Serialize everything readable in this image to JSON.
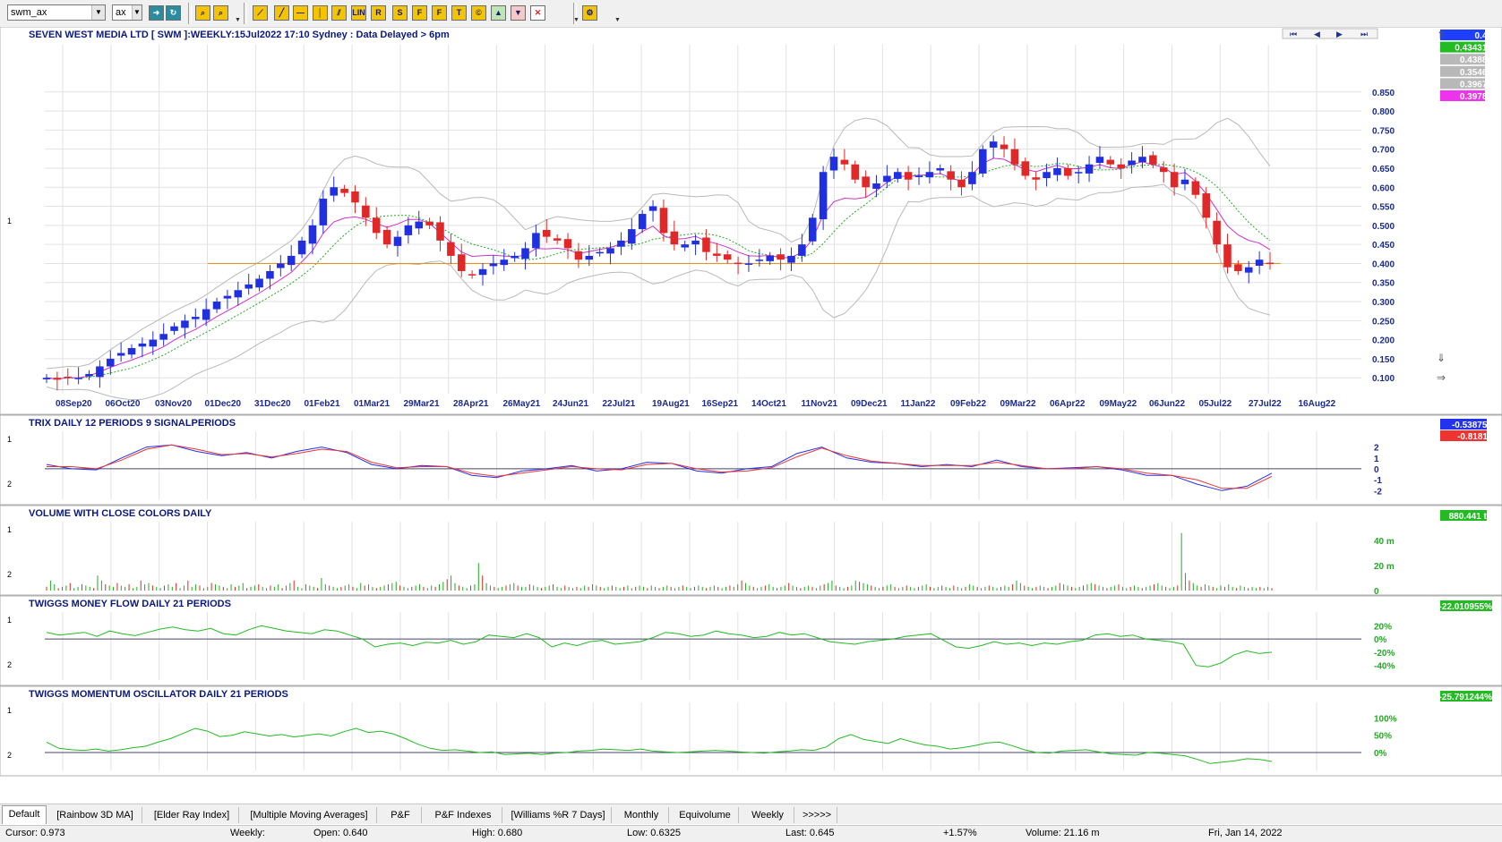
{
  "toolbar": {
    "symbol_value": "swm_ax",
    "exchange_value": "ax",
    "buttons": [
      {
        "name": "binoculars-icon",
        "glyph": "⌕"
      },
      {
        "name": "binoculars-disabled-icon",
        "glyph": "⌕"
      },
      {
        "name": "trendline-icon",
        "glyph": "⟋"
      },
      {
        "name": "line-icon",
        "glyph": "╱"
      },
      {
        "name": "horizontal-line-icon",
        "glyph": "—"
      },
      {
        "name": "vertical-line-icon",
        "glyph": "│"
      },
      {
        "name": "parallel-lines-icon",
        "glyph": "⫽"
      },
      {
        "name": "lin-regression-icon",
        "glyph": "LIN"
      },
      {
        "name": "raff-channel-icon",
        "glyph": "R"
      },
      {
        "name": "std-channel-icon",
        "glyph": "S"
      },
      {
        "name": "fib-icon",
        "glyph": "F"
      },
      {
        "name": "fib-time-icon",
        "glyph": "F"
      },
      {
        "name": "text-note-icon",
        "glyph": "T"
      },
      {
        "name": "copyright-icon",
        "glyph": "©"
      },
      {
        "name": "up-arrow-icon",
        "glyph": "▲"
      },
      {
        "name": "down-arrow-icon",
        "glyph": "▼"
      },
      {
        "name": "delete-icon",
        "glyph": "✕"
      },
      {
        "name": "settings-tool-icon",
        "glyph": "⚙"
      }
    ]
  },
  "main_chart": {
    "title": "SEVEN WEST MEDIA LTD [ SWM ]:WEEKLY:15Jul2022 17:10 Sydney : Data Delayed > 6pm",
    "y_ticks": [
      "0.850",
      "0.800",
      "0.750",
      "0.700",
      "0.650",
      "0.600",
      "0.550",
      "0.500",
      "0.450",
      "0.400",
      "0.350",
      "0.300",
      "0.250",
      "0.200",
      "0.150",
      "0.100"
    ],
    "x_ticks": [
      "08Sep20",
      "06Oct20",
      "03Nov20",
      "01Dec20",
      "31Dec20",
      "01Feb21",
      "01Mar21",
      "29Mar21",
      "28Apr21",
      "26May21",
      "24Jun21",
      "22Jul21",
      "19Aug21",
      "16Sep21",
      "14Oct21",
      "11Nov21",
      "09Dec21",
      "11Jan22",
      "09Feb22",
      "09Mar22",
      "06Apr22",
      "09May22",
      "06Jun22",
      "05Jul22",
      "27Jul22",
      "16Aug22"
    ],
    "value_boxes": [
      {
        "text": "0.40",
        "color": "#1f3fff"
      },
      {
        "text": "0.434316",
        "color": "#22bb22"
      },
      {
        "text": "0.43882",
        "color": "#b8b8b8"
      },
      {
        "text": "0.35468",
        "color": "#b8b8b8"
      },
      {
        "text": "0.39675",
        "color": "#b8b8b8"
      },
      {
        "text": "0.39789",
        "color": "#ee33ee"
      }
    ],
    "left_marker": "1",
    "ref_line_value": 0.4
  },
  "chart_data": [
    {
      "type": "candlestick",
      "title": "SEVEN WEST MEDIA LTD [ SWM ]:WEEKLY:15Jul2022 17:10 Sydney : Data Delayed > 6pm",
      "ylim": [
        0.07,
        0.88
      ],
      "series": [
        {
          "name": "SWM weekly",
          "closes": [
            0.1,
            0.095,
            0.103,
            0.1,
            0.11,
            0.13,
            0.15,
            0.165,
            0.178,
            0.19,
            0.2,
            0.215,
            0.235,
            0.25,
            0.26,
            0.28,
            0.3,
            0.315,
            0.33,
            0.345,
            0.36,
            0.38,
            0.4,
            0.42,
            0.46,
            0.5,
            0.57,
            0.6,
            0.585,
            0.56,
            0.52,
            0.48,
            0.45,
            0.47,
            0.5,
            0.51,
            0.5,
            0.46,
            0.42,
            0.38,
            0.37,
            0.385,
            0.4,
            0.41,
            0.42,
            0.44,
            0.48,
            0.47,
            0.46,
            0.44,
            0.41,
            0.42,
            0.43,
            0.44,
            0.46,
            0.49,
            0.53,
            0.55,
            0.48,
            0.45,
            0.45,
            0.46,
            0.43,
            0.42,
            0.41,
            0.4,
            0.4,
            0.41,
            0.42,
            0.41,
            0.42,
            0.45,
            0.52,
            0.64,
            0.68,
            0.66,
            0.62,
            0.6,
            0.61,
            0.63,
            0.64,
            0.62,
            0.63,
            0.64,
            0.65,
            0.62,
            0.6,
            0.64,
            0.7,
            0.72,
            0.7,
            0.66,
            0.63,
            0.62,
            0.64,
            0.65,
            0.63,
            0.64,
            0.66,
            0.68,
            0.66,
            0.65,
            0.67,
            0.68,
            0.66,
            0.64,
            0.6,
            0.62,
            0.58,
            0.52,
            0.45,
            0.39,
            0.38,
            0.39,
            0.41,
            0.4
          ]
        }
      ]
    },
    {
      "type": "line",
      "title": "TRIX DAILY 12 PERIODS 9 SIGNALPERIODS",
      "ylim": [
        -2.8,
        3.2
      ],
      "y_ticks": [
        "2",
        "1",
        "0",
        "-1",
        "-2"
      ],
      "series": [
        {
          "values": [
            0.4,
            0.0,
            -0.1,
            1.0,
            2.0,
            2.2,
            1.6,
            1.2,
            1.5,
            1.0,
            1.6,
            2.0,
            1.5,
            0.4,
            0.0,
            0.3,
            0.2,
            -0.6,
            -0.8,
            -0.2,
            0.0,
            0.3,
            -0.2,
            0.0,
            0.6,
            0.5,
            -0.2,
            -0.4,
            0.0,
            0.2,
            1.4,
            2.0,
            1.0,
            0.6,
            0.5,
            0.2,
            0.4,
            0.2,
            0.8,
            0.2,
            0.0,
            0.1,
            0.2,
            -0.1,
            -0.6,
            -0.6,
            -1.4,
            -2.0,
            -1.6,
            -0.4
          ]
        },
        {
          "values": [
            0.2,
            0.2,
            0.0,
            0.8,
            1.8,
            2.2,
            1.8,
            1.3,
            1.4,
            1.1,
            1.4,
            1.8,
            1.6,
            0.6,
            0.1,
            0.2,
            0.2,
            -0.4,
            -0.7,
            -0.4,
            -0.1,
            0.2,
            0.0,
            -0.1,
            0.4,
            0.5,
            0.0,
            -0.3,
            -0.2,
            0.1,
            1.1,
            1.9,
            1.2,
            0.7,
            0.5,
            0.3,
            0.3,
            0.3,
            0.6,
            0.3,
            0.0,
            0.0,
            0.2,
            0.0,
            -0.4,
            -0.6,
            -1.0,
            -1.8,
            -1.8,
            -0.7
          ]
        }
      ]
    },
    {
      "type": "bar",
      "title": "VOLUME WITH CLOSE COLORS DAILY",
      "ylim": [
        0,
        50
      ],
      "y_ticks": [
        "40 m",
        "20 m",
        "0"
      ],
      "values": [
        3,
        8,
        5,
        2,
        3,
        4,
        6,
        2,
        3,
        5,
        4,
        3,
        2,
        12,
        8,
        5,
        4,
        3,
        6,
        4,
        3,
        5,
        2,
        3,
        8,
        5,
        6,
        4,
        3,
        2,
        4,
        5,
        3,
        6,
        2,
        4,
        8,
        3,
        5,
        4,
        2,
        3,
        6,
        5,
        4,
        3,
        2,
        5,
        3,
        4,
        6,
        2,
        3,
        4,
        5,
        3,
        2,
        4,
        3,
        5,
        2,
        4,
        6,
        8,
        3,
        2,
        5,
        4,
        3,
        2,
        10,
        5,
        4,
        3,
        2,
        3,
        4,
        5,
        3,
        2,
        6,
        4,
        5,
        3,
        2,
        3,
        4,
        5,
        6,
        7,
        4,
        3,
        2,
        3,
        4,
        5,
        3,
        2,
        4,
        3,
        5,
        7,
        9,
        12,
        6,
        4,
        3,
        2,
        4,
        5,
        22,
        12,
        6,
        4,
        3,
        2,
        3,
        4,
        5,
        6,
        4,
        3,
        3,
        5,
        4,
        3,
        2,
        3,
        4,
        5,
        3,
        2,
        4,
        3,
        2,
        3,
        2,
        4,
        3,
        5,
        4,
        3,
        2,
        3,
        4,
        3,
        2,
        3,
        4,
        2,
        3,
        4,
        3,
        2,
        4,
        3,
        2,
        3,
        4,
        3,
        2,
        3,
        4,
        3,
        2,
        3,
        4,
        3,
        2,
        3,
        4,
        3,
        2,
        3,
        4,
        3,
        5,
        8,
        6,
        4,
        3,
        2,
        3,
        4,
        5,
        3,
        2,
        3,
        4,
        6,
        4,
        3,
        2,
        3,
        4,
        3,
        2,
        4,
        5,
        6,
        8,
        4,
        3,
        2,
        3,
        4,
        8,
        7,
        6,
        5,
        4,
        3,
        2,
        3,
        4,
        5,
        3,
        2,
        3,
        4,
        3,
        2,
        3,
        4,
        5,
        3,
        2,
        3,
        4,
        3,
        2,
        4,
        3,
        2,
        3,
        5,
        4,
        3,
        2,
        3,
        4,
        3,
        2,
        3,
        4,
        3,
        5,
        8,
        6,
        4,
        3,
        2,
        3,
        4,
        3,
        2,
        3,
        4,
        6,
        5,
        4,
        3,
        2,
        3,
        4,
        5,
        6,
        5,
        4,
        3,
        2,
        3,
        4,
        5,
        3,
        2,
        3,
        4,
        3,
        2,
        3,
        4,
        5,
        6,
        4,
        3,
        2,
        3,
        4,
        46,
        14,
        8,
        6,
        4,
        3,
        5,
        4,
        3,
        2,
        4,
        3,
        5,
        3,
        2,
        4,
        3,
        2,
        3,
        2,
        3,
        2,
        3,
        2
      ]
    },
    {
      "type": "line",
      "title": "TWIGGS MONEY FLOW DAILY 21 PERIODS",
      "ylim": [
        -62,
        38
      ],
      "y_ticks": [
        "20%",
        "0%",
        "-20%",
        "-40%"
      ],
      "values": [
        10,
        6,
        8,
        10,
        4,
        12,
        8,
        5,
        10,
        15,
        18,
        14,
        12,
        16,
        8,
        6,
        14,
        20,
        16,
        12,
        10,
        8,
        14,
        12,
        6,
        0,
        -12,
        -8,
        -6,
        -10,
        -5,
        -6,
        -2,
        -8,
        -4,
        6,
        4,
        2,
        8,
        2,
        -12,
        -6,
        -10,
        -4,
        -2,
        -8,
        -6,
        -4,
        2,
        10,
        8,
        4,
        6,
        12,
        8,
        6,
        2,
        4,
        10,
        6,
        8,
        2,
        -4,
        -6,
        -8,
        -4,
        -2,
        0,
        4,
        6,
        8,
        -2,
        -12,
        -14,
        -10,
        -4,
        -8,
        -6,
        -10,
        -6,
        -8,
        -4,
        -2,
        6,
        8,
        4,
        6,
        0,
        -2,
        -4,
        -8,
        -40,
        -42,
        -36,
        -24,
        -18,
        -22,
        -20
      ]
    },
    {
      "type": "line",
      "title": "TWIGGS MOMENTUM OSCILLATOR DAILY 21 PERIODS",
      "ylim": [
        -52,
        140
      ],
      "y_ticks": [
        "100%",
        "50%",
        "0%"
      ],
      "values": [
        30,
        12,
        8,
        6,
        10,
        4,
        8,
        14,
        18,
        30,
        40,
        55,
        70,
        62,
        46,
        50,
        60,
        54,
        48,
        52,
        45,
        50,
        54,
        48,
        60,
        70,
        58,
        62,
        54,
        40,
        24,
        12,
        6,
        8,
        4,
        0,
        2,
        -6,
        -4,
        -2,
        -6,
        -2,
        0,
        4,
        6,
        10,
        8,
        6,
        10,
        4,
        2,
        0,
        2,
        4,
        6,
        4,
        2,
        0,
        -2,
        2,
        4,
        8,
        6,
        16,
        40,
        52,
        38,
        32,
        26,
        40,
        30,
        22,
        18,
        10,
        14,
        20,
        28,
        30,
        20,
        8,
        0,
        -2,
        4,
        6,
        8,
        2,
        -4,
        -6,
        -8,
        0,
        -2,
        -6,
        -10,
        -20,
        -32,
        -28,
        -24,
        -18,
        -20,
        -26
      ]
    }
  ],
  "trix_panel": {
    "title": "TRIX DAILY 12 PERIODS 9 SIGNALPERIODS",
    "value_boxes": [
      {
        "text": "-0.538755",
        "color": "#2233ee"
      },
      {
        "text": "-0.81811",
        "color": "#ee3333"
      }
    ],
    "left_top": "1",
    "left_bottom": "2"
  },
  "volume_panel": {
    "title": "VOLUME WITH CLOSE COLORS DAILY",
    "value_box": {
      "text": "880.441 th",
      "color": "#22bb22"
    },
    "left_top": "1",
    "left_bottom": "2"
  },
  "mf_panel": {
    "title": "TWIGGS MONEY FLOW DAILY 21 PERIODS",
    "value_box": {
      "text": "-22.010955%",
      "color": "#22bb22"
    },
    "left_top": "1",
    "left_bottom": "2"
  },
  "mo_panel": {
    "title": "TWIGGS MOMENTUM OSCILLATOR DAILY 21 PERIODS",
    "value_box": {
      "text": "-25.791244%",
      "color": "#22bb22"
    },
    "left_top": "1",
    "left_bottom": "2"
  },
  "tabs": [
    "Default",
    "[Rainbow 3D MA]",
    "[Elder Ray Index]",
    "[Multiple Moving Averages]",
    "P&F",
    "P&F Indexes",
    "[Williams %R 7 Days]",
    "Monthly",
    "Equivolume",
    "Weekly",
    ">>>>>"
  ],
  "status": {
    "cursor": "Cursor: 0.973",
    "period": "Weekly:",
    "open": "Open: 0.640",
    "high": "High: 0.680",
    "low": "Low: 0.6325",
    "last": "Last: 0.645",
    "change": "+1.57%",
    "volume": "Volume: 21.16 m",
    "date": "Fri, Jan 14, 2022"
  }
}
